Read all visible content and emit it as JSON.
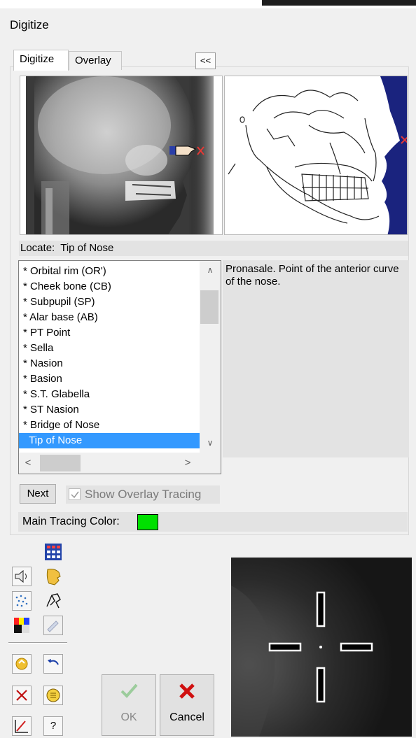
{
  "window": {
    "title": "Digitize"
  },
  "tabs": [
    {
      "label": "Digitize",
      "active": true
    },
    {
      "label": "Overlay",
      "active": false
    }
  ],
  "collapse_button": "<<",
  "locate": {
    "label": "Locate:",
    "value": "Tip of Nose"
  },
  "landmarks": [
    "* Orbital rim (OR')",
    "* Cheek bone (CB)",
    "* Subpupil (SP)",
    "* Alar base (AB)",
    "* PT Point",
    "* Sella",
    "* Nasion",
    "* Basion",
    "* S.T. Glabella",
    "* ST Nasion",
    "* Bridge of Nose",
    "  Tip of Nose"
  ],
  "selected_landmark": "  Tip of Nose",
  "description": "Pronasale. Point of the anterior curve of the nose.",
  "buttons": {
    "next": "Next",
    "show_overlay_tracing": "Show Overlay Tracing",
    "ok": "OK",
    "cancel": "Cancel",
    "help": "?"
  },
  "show_overlay_tracing_checked": true,
  "main_tracing_color": {
    "label": "Main Tracing Color:",
    "value": "#00e000"
  },
  "colors": {
    "accent": "#3399ff",
    "tracing_bg": "#1a237e",
    "marker": "#e53935"
  },
  "toolbar_icons": [
    "grid-icon",
    "sound-icon",
    "face-icon",
    "dots-icon",
    "skeleton-icon",
    "palette-icon",
    "pencil-icon",
    "refresh-icon",
    "undo-icon",
    "delete-icon",
    "calculator-icon",
    "erase-icon",
    "help-icon"
  ]
}
